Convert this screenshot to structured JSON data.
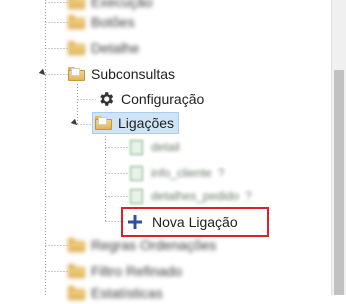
{
  "tree": {
    "items_top": [
      {
        "label": "Execução"
      },
      {
        "label": "Botões"
      },
      {
        "label": "Detalhe"
      }
    ],
    "subconsultas": {
      "label": "Subconsultas",
      "children": {
        "configuracao": {
          "label": "Configuração"
        },
        "ligacoes": {
          "label": "Ligações",
          "children": [
            {
              "label": "detail"
            },
            {
              "label": "info_cliente"
            },
            {
              "label": "detalhes_pedido"
            }
          ],
          "new_link": {
            "label": "Nova Ligação"
          }
        }
      }
    },
    "items_bottom": [
      {
        "label": "Regras Ordenações"
      },
      {
        "label": "Filtro Refinado"
      },
      {
        "label": "Estatísticas"
      }
    ],
    "help_mark": "?"
  },
  "colors": {
    "selection_bg": "#cfe5f6",
    "highlight_border": "#d8232a",
    "plus_icon": "#2e4fa3"
  }
}
